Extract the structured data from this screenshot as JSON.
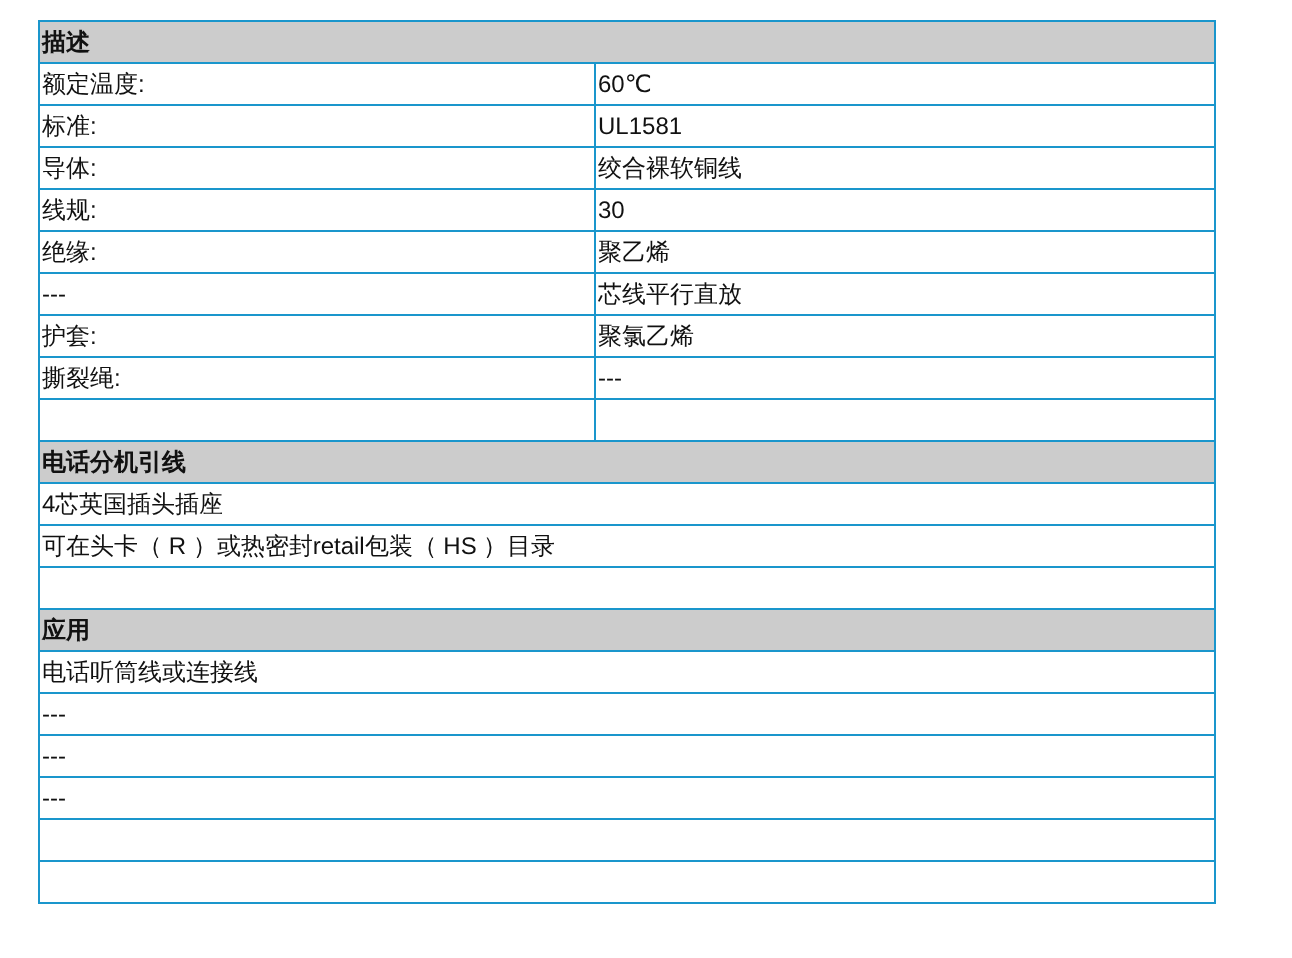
{
  "sections": [
    {
      "heading": "描述",
      "rows": [
        {
          "kind": "pair",
          "label": "额定温度:",
          "value": "60℃"
        },
        {
          "kind": "pair",
          "label": "标准:",
          "value": "UL1581"
        },
        {
          "kind": "pair",
          "label": "导体:",
          "value": "绞合裸软铜线"
        },
        {
          "kind": "pair",
          "label": "线规:",
          "value": "30"
        },
        {
          "kind": "pair",
          "label": "绝缘:",
          "value": "聚乙烯"
        },
        {
          "kind": "pair",
          "label": "---",
          "value": "芯线平行直放"
        },
        {
          "kind": "pair",
          "label": "护套:",
          "value": "聚氯乙烯"
        },
        {
          "kind": "pair",
          "label": "撕裂绳:",
          "value": "---"
        },
        {
          "kind": "empty_pair"
        }
      ]
    },
    {
      "heading": "电话分机引线",
      "rows": [
        {
          "kind": "line",
          "text": "4芯英国插头插座"
        },
        {
          "kind": "line",
          "text": "可在头卡（ R ）或热密封retail包装（ HS ）目录"
        },
        {
          "kind": "empty"
        }
      ]
    },
    {
      "heading": "应用",
      "rows": [
        {
          "kind": "line",
          "text": "电话听筒线或连接线"
        },
        {
          "kind": "line",
          "text": "---"
        },
        {
          "kind": "line",
          "text": "---"
        },
        {
          "kind": "line",
          "text": "---"
        },
        {
          "kind": "empty"
        },
        {
          "kind": "empty"
        }
      ]
    }
  ]
}
